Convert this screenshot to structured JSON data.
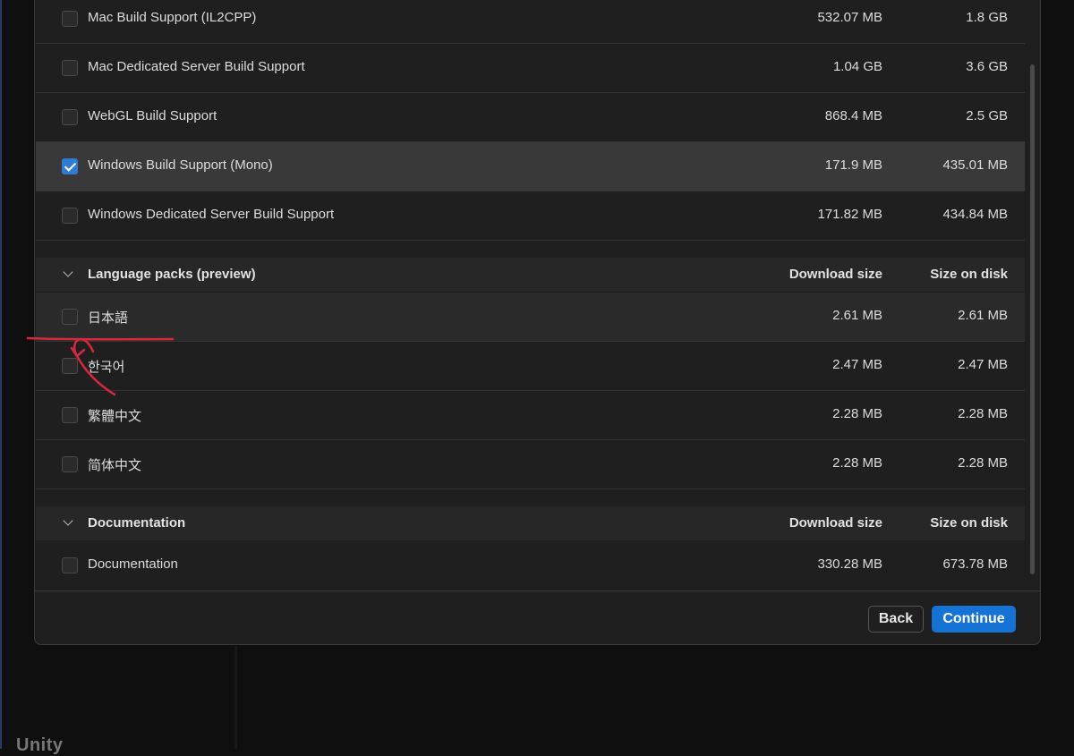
{
  "platform_rows": [
    {
      "name": "Mac Build Support (IL2CPP)",
      "download": "532.07 MB",
      "disk": "1.8 GB",
      "checked": false
    },
    {
      "name": "Mac Dedicated Server Build Support",
      "download": "1.04 GB",
      "disk": "3.6 GB",
      "checked": false
    },
    {
      "name": "WebGL Build Support",
      "download": "868.4 MB",
      "disk": "2.5 GB",
      "checked": false
    },
    {
      "name": "Windows Build Support (Mono)",
      "download": "171.9 MB",
      "disk": "435.01 MB",
      "checked": true
    },
    {
      "name": "Windows Dedicated Server Build Support",
      "download": "171.82 MB",
      "disk": "434.84 MB",
      "checked": false
    }
  ],
  "language_section": {
    "title": "Language packs (preview)",
    "download_header": "Download size",
    "disk_header": "Size on disk",
    "rows": [
      {
        "name": "日本語",
        "download": "2.61 MB",
        "disk": "2.61 MB",
        "checked": false
      },
      {
        "name": "한국어",
        "download": "2.47 MB",
        "disk": "2.47 MB",
        "checked": false
      },
      {
        "name": "繁體中文",
        "download": "2.28 MB",
        "disk": "2.28 MB",
        "checked": false
      },
      {
        "name": "简体中文",
        "download": "2.28 MB",
        "disk": "2.28 MB",
        "checked": false
      }
    ]
  },
  "documentation_section": {
    "title": "Documentation",
    "download_header": "Download size",
    "disk_header": "Size on disk",
    "rows": [
      {
        "name": "Documentation",
        "download": "330.28 MB",
        "disk": "673.78 MB",
        "checked": false
      }
    ]
  },
  "footer": {
    "back_label": "Back",
    "continue_label": "Continue"
  },
  "background": {
    "logo_text": "Unity"
  },
  "colors": {
    "accent": "#1673d6",
    "annotation": "#d8283b"
  }
}
